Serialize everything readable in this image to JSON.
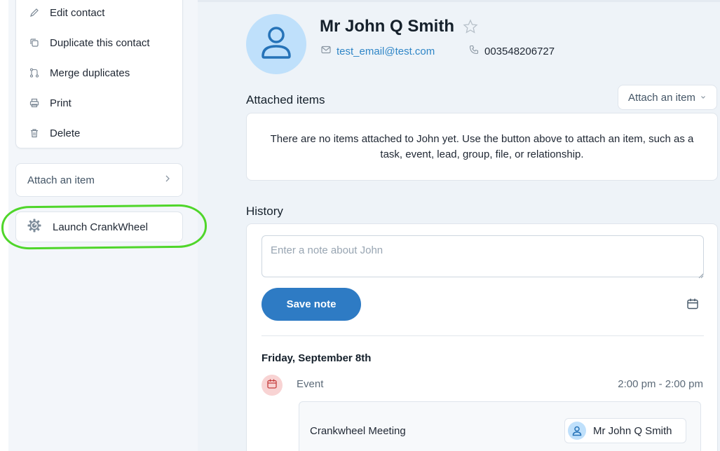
{
  "sidebar": {
    "menu": [
      {
        "label": "Edit contact",
        "icon": "pencil-icon"
      },
      {
        "label": "Duplicate this contact",
        "icon": "copy-icon"
      },
      {
        "label": "Merge duplicates",
        "icon": "merge-icon"
      },
      {
        "label": "Print",
        "icon": "printer-icon"
      },
      {
        "label": "Delete",
        "icon": "trash-icon"
      }
    ],
    "attach_item": {
      "label": "Attach an item",
      "icon": "chevron-right-icon"
    },
    "crankwheel": {
      "label": "Launch CrankWheel",
      "icon": "crankwheel-gear-icon"
    }
  },
  "contact": {
    "name": "Mr John Q Smith",
    "email": "test_email@test.com",
    "phone": "003548206727"
  },
  "attached": {
    "title": "Attached items",
    "button_label": "Attach an item",
    "empty_message": "There are no items attached to John yet. Use the button above to attach an item, such as a task, event, lead, group, file, or relationship."
  },
  "history": {
    "title": "History",
    "note_placeholder": "Enter a note about John",
    "save_label": "Save note",
    "date": "Friday, September 8th",
    "event": {
      "type": "Event",
      "time": "2:00 pm - 2:00 pm",
      "title": "Crankwheel Meeting",
      "contact": "Mr John Q Smith"
    }
  },
  "colors": {
    "accent": "#2e7bc4",
    "link": "#2f86c7",
    "avatar_bg": "#bfe0fb",
    "event_icon_bg": "#f8d3d3",
    "highlight": "#4fd62a",
    "page_bg": "#eef3f8"
  }
}
